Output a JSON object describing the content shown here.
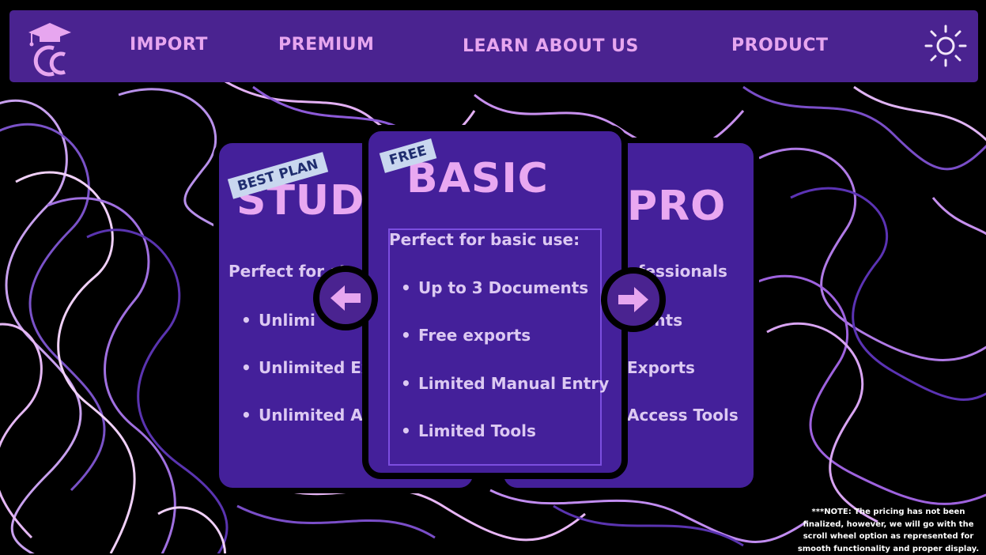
{
  "nav": {
    "items": [
      "IMPORT",
      "PREMIUM",
      "LEARN ABOUT US",
      "PRODUCT"
    ],
    "logo_icon": "graduation-cap-cc-logo",
    "theme_icon": "sun-icon"
  },
  "cards": {
    "student": {
      "tag": "BEST PLAN",
      "title": "STUD",
      "description": "Perfect for st",
      "features": [
        "Unlimi",
        "Unlimited Ex",
        "Unlimited Ac"
      ]
    },
    "basic": {
      "tag": "FREE",
      "title": "BASIC",
      "description": "Perfect for basic use:",
      "features": [
        "Up to 3 Documents",
        "Free exports",
        "Limited Manual Entry",
        "Limited Tools"
      ]
    },
    "pro": {
      "title": "PRO",
      "description": "ofessionals",
      "features": [
        "ments",
        "Exports",
        "Access Tools"
      ]
    }
  },
  "arrows": {
    "left_icon": "arrow-left-icon",
    "right_icon": "arrow-right-icon"
  },
  "note": "***NOTE: The pricing has not been finalized, however, we will go with the scroll wheel option as represented for smooth functionality and proper display.",
  "colors": {
    "background": "#000000",
    "navbar": "#4a2390",
    "card": "#44209a",
    "accent_pink": "#e9a8f1",
    "text_light": "#dcc9f2",
    "tag_bg": "#c9d7ef",
    "tag_text": "#1f2d6f"
  }
}
